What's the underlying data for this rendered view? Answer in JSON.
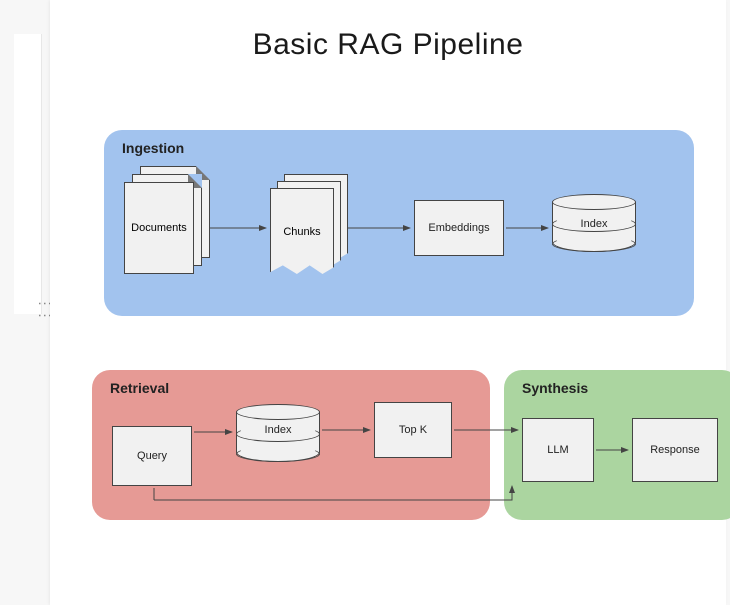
{
  "title": "Basic RAG Pipeline",
  "ui": {
    "drag_handle_glyph": "⋮⋮"
  },
  "panels": {
    "ingestion": {
      "label": "Ingestion",
      "color": "#a2c3ee",
      "nodes": {
        "documents": "Documents",
        "chunks": "Chunks",
        "embeddings": "Embeddings",
        "index": "Index"
      },
      "edges": [
        [
          "documents",
          "chunks"
        ],
        [
          "chunks",
          "embeddings"
        ],
        [
          "embeddings",
          "index"
        ]
      ]
    },
    "retrieval": {
      "label": "Retrieval",
      "color": "#e69a95",
      "nodes": {
        "query": "Query",
        "index": "Index",
        "topk": "Top K"
      },
      "edges": [
        [
          "query",
          "index"
        ],
        [
          "index",
          "topk"
        ],
        [
          "query",
          "synthesis.llm"
        ]
      ]
    },
    "synthesis": {
      "label": "Synthesis",
      "color": "#abd5a0",
      "nodes": {
        "llm": "LLM",
        "response": "Response"
      },
      "edges": [
        [
          "retrieval.topk",
          "llm"
        ],
        [
          "llm",
          "response"
        ]
      ]
    }
  }
}
